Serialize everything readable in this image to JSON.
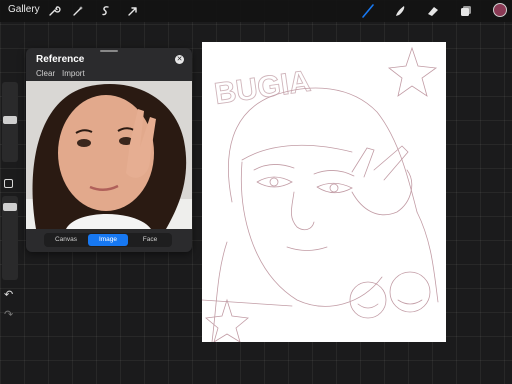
{
  "topbar": {
    "gallery_label": "Gallery",
    "left_icons": [
      "wrench-icon",
      "magic-wand-icon",
      "selection-icon",
      "transform-arrow-icon"
    ],
    "right_icons": [
      "brush-icon",
      "smudge-icon",
      "eraser-icon",
      "layers-icon"
    ],
    "active_tool_color": "#1778f2",
    "current_color": "#8a3a55"
  },
  "sidebar": {
    "undo_icon": "undo-icon",
    "redo_icon": "redo-icon"
  },
  "reference": {
    "title": "Reference",
    "clear_label": "Clear",
    "import_label": "Import",
    "tabs": [
      {
        "label": "Canvas",
        "active": false
      },
      {
        "label": "Image",
        "active": true
      },
      {
        "label": "Face",
        "active": false
      }
    ],
    "accent_color": "#1778f2"
  },
  "canvas": {
    "sketch_text": "BUGIA",
    "sketch_color": "#b78a95"
  }
}
